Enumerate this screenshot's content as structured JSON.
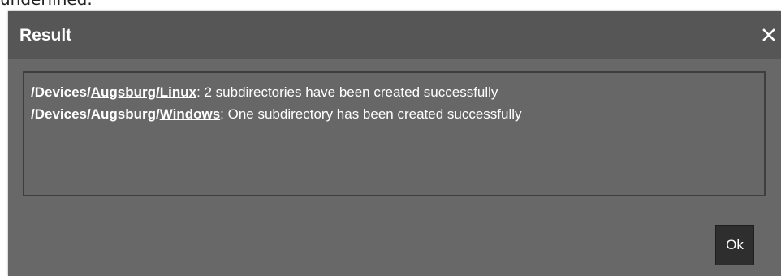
{
  "background_text": "underlined.",
  "dialog": {
    "title": "Result",
    "close_glyph": "×",
    "lines": [
      {
        "prefix": "/Devices/",
        "link": "Augsburg/Linux",
        "message": ": 2 subdirectories have been created successfully"
      },
      {
        "prefix": "/Devices/Augsburg/",
        "link": "Windows",
        "message": ": One subdirectory has been created successfully"
      }
    ],
    "ok_label": "Ok"
  },
  "colors": {
    "dialog_body": "#686868",
    "dialog_header": "#565656",
    "result_border": "#3e3e3e",
    "ok_button": "#2e2e2e",
    "text": "#ffffff"
  }
}
